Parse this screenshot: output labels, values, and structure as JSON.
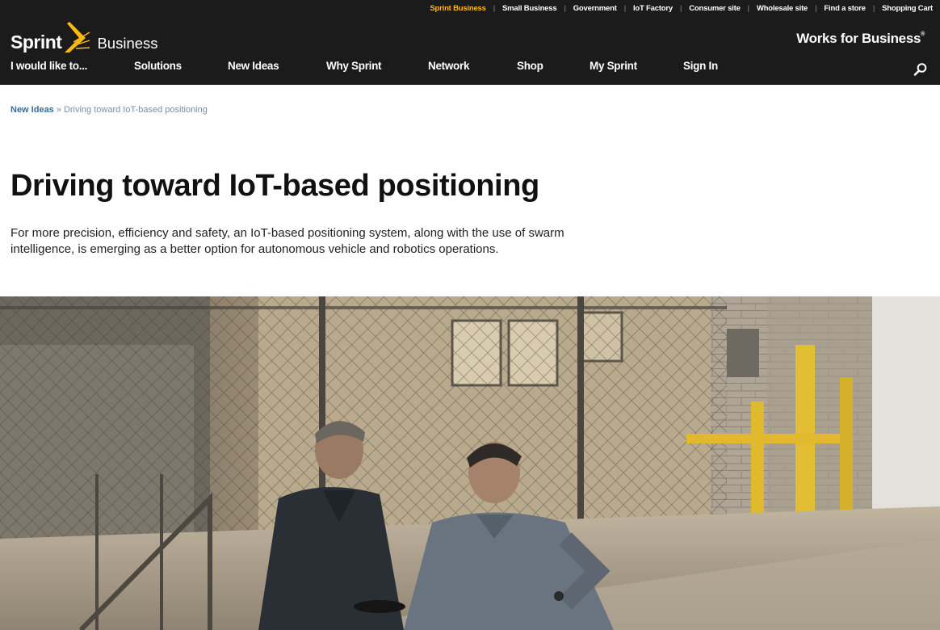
{
  "header": {
    "utility_links": [
      {
        "label": "Sprint Business",
        "active": true
      },
      {
        "label": "Small Business"
      },
      {
        "label": "Government"
      },
      {
        "label": "IoT Factory"
      },
      {
        "label": "Consumer site"
      },
      {
        "label": "Wholesale site"
      },
      {
        "label": "Find a store"
      },
      {
        "label": "Shopping Cart"
      }
    ],
    "logo": {
      "brand": "Sprint",
      "sub": "Business",
      "icon": "sprint-burst-logo"
    },
    "tagline": "Works for Business",
    "tagline_mark": "®",
    "nav": [
      {
        "label": "I would like to..."
      },
      {
        "label": "Solutions"
      },
      {
        "label": "New Ideas"
      },
      {
        "label": "Why Sprint"
      },
      {
        "label": "Network"
      },
      {
        "label": "Shop"
      },
      {
        "label": "My Sprint"
      },
      {
        "label": "Sign In"
      }
    ],
    "search_icon": "search-icon"
  },
  "breadcrumb": {
    "parent": "New Ideas",
    "separator": "»",
    "current": "Driving toward IoT-based positioning"
  },
  "article": {
    "title": "Driving toward IoT-based positioning",
    "intro": "For more precision, efficiency and safety, an IoT-based positioning system, along with the use of swarm intelligence, is emerging as a better option for autonomous vehicle and robotics operations."
  },
  "colors": {
    "header_bg": "#1b1b1b",
    "brand_yellow": "#fdb913",
    "breadcrumb_link": "#3a6a96",
    "text": "#111111"
  }
}
